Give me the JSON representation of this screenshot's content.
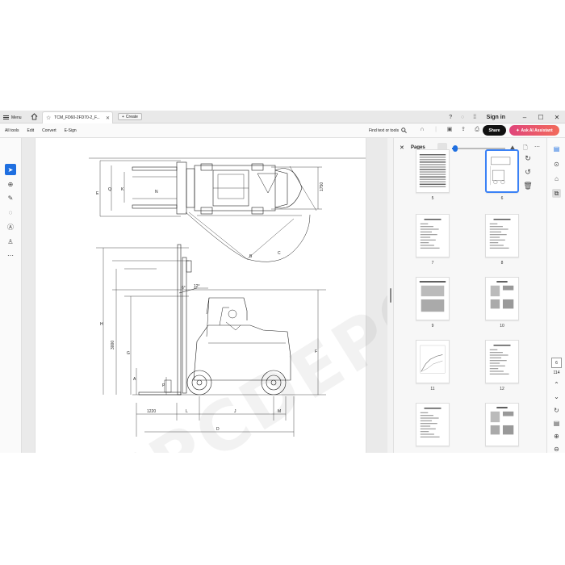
{
  "titlebar": {
    "menu_label": "Menu",
    "tab_title": "TCM_FD60-2FD70-2_F...",
    "create_label": "Create",
    "signin_label": "Sign in"
  },
  "toolbar": {
    "menus": [
      "All tools",
      "Edit",
      "Convert",
      "E-Sign"
    ],
    "find_label": "Find text or tools",
    "share_label": "Share",
    "ai_label": "Ask AI Assistant"
  },
  "drawing": {
    "top_view_labels": [
      "E",
      "Q",
      "K",
      "N",
      "1750",
      "B",
      "C"
    ],
    "side_view_labels": [
      "6°",
      "12°",
      "H",
      "3000",
      "G",
      "F",
      "A",
      "P"
    ],
    "bottom_dims": [
      "1220",
      "L",
      "J",
      "M",
      "D"
    ]
  },
  "pages_panel": {
    "title": "Pages",
    "zoom_fraction": 0.03,
    "thumbnails": [
      {
        "num": "5",
        "selected": false
      },
      {
        "num": "6",
        "selected": true
      },
      {
        "num": "7",
        "selected": false
      },
      {
        "num": "8",
        "selected": false
      },
      {
        "num": "9",
        "selected": false
      },
      {
        "num": "10",
        "selected": false
      },
      {
        "num": "11",
        "selected": false
      },
      {
        "num": "12",
        "selected": false
      },
      {
        "num": "",
        "selected": false
      },
      {
        "num": "",
        "selected": false
      }
    ]
  },
  "page_nav": {
    "current": "6",
    "total": "114"
  },
  "watermark": "EPCDEPO.COM",
  "colors": {
    "accent": "#1f6fe0",
    "share_bg": "#111111",
    "ai_gradient_start": "#e0457b",
    "ai_gradient_end": "#f26b5b"
  }
}
